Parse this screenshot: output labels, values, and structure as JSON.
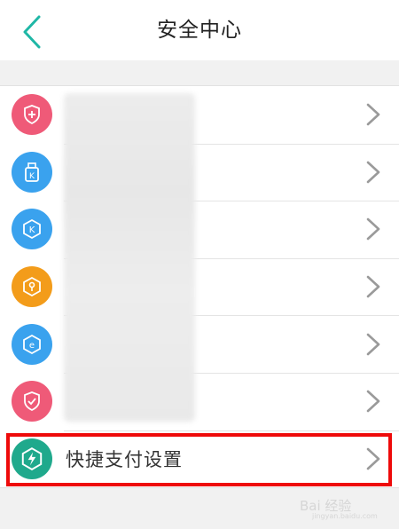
{
  "header": {
    "title": "安全中心",
    "back_icon": "chevron-left-icon",
    "back_color": "#1fb7a6"
  },
  "list": {
    "items": [
      {
        "icon": "shield-plus-icon",
        "color": "#ef5a78",
        "label": ""
      },
      {
        "icon": "usb-key-icon",
        "color": "#3aa2ee",
        "label": ""
      },
      {
        "icon": "hexagon-k-icon",
        "color": "#3aa2ee",
        "label": ""
      },
      {
        "icon": "hexagon-lock-icon",
        "color": "#f39c1a",
        "label": ""
      },
      {
        "icon": "hexagon-e-icon",
        "color": "#3aa2ee",
        "label": ""
      },
      {
        "icon": "shield-check-icon",
        "color": "#ef5a78",
        "label": ""
      },
      {
        "icon": "hexagon-lightning-icon",
        "color": "#1fa98c",
        "label": "快捷支付设置"
      }
    ]
  },
  "watermark": {
    "text": "Bai 经验",
    "sub": "jingyan.baidu.com"
  }
}
